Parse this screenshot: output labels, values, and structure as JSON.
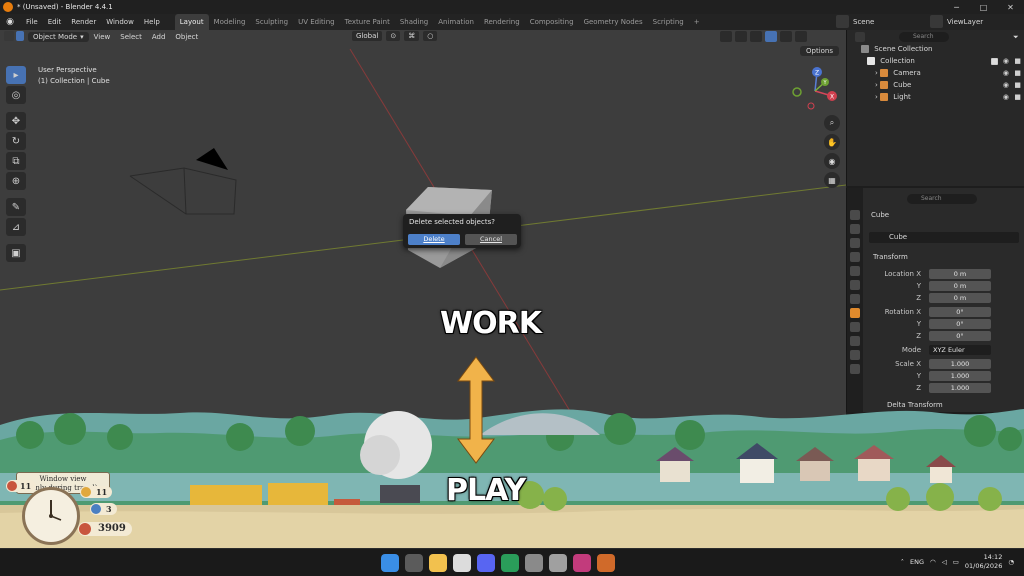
{
  "window": {
    "title": "* (Unsaved) - Blender 4.4.1",
    "minimize": "─",
    "maximize": "□",
    "close": "✕"
  },
  "menu": [
    "File",
    "Edit",
    "Render",
    "Window",
    "Help"
  ],
  "workspace_tabs": [
    "Layout",
    "Modeling",
    "Sculpting",
    "UV Editing",
    "Texture Paint",
    "Shading",
    "Animation",
    "Rendering",
    "Compositing",
    "Geometry Nodes",
    "Scripting"
  ],
  "workspace_add": "+",
  "scene_name": "Scene",
  "view_layer": "ViewLayer",
  "viewport": {
    "mode": "Object Mode",
    "menu": [
      "View",
      "Select",
      "Add",
      "Object"
    ],
    "orientation": "Global",
    "options_label": "Options",
    "perspective_label": "User Perspective",
    "collection_label": "(1) Collection | Cube",
    "gizmo_axes": [
      "Z",
      "X",
      "Y"
    ]
  },
  "dialog": {
    "question": "Delete selected objects?",
    "delete_label": "Delete",
    "cancel_label": "Cancel"
  },
  "overlay": {
    "top_text": "WORK",
    "bottom_text": "PLAY"
  },
  "game_widget": {
    "window_view_line1": "Window view",
    "window_view_line2": "(only during travel)",
    "counters": [
      "11",
      "3",
      "11"
    ],
    "money": "3909"
  },
  "outliner": {
    "search_placeholder": "Search",
    "scene_collection": "Scene Collection",
    "collection": "Collection",
    "objects": [
      "Camera",
      "Cube",
      "Light"
    ]
  },
  "properties": {
    "search_placeholder": "Search",
    "object_name": "Cube",
    "data_name": "Cube",
    "transform_header": "Transform",
    "location_label": "Location X",
    "location": [
      "0 m",
      "0 m",
      "0 m"
    ],
    "rotation_label": "Rotation X",
    "rotation": [
      "0°",
      "0°",
      "0°"
    ],
    "mode_label": "Mode",
    "rotation_mode": "XYZ Euler",
    "scale_label": "Scale X",
    "scale": [
      "1.000",
      "1.000",
      "1.000"
    ],
    "axis_y": "Y",
    "axis_z": "Z",
    "delta_transform": "Delta Transform"
  },
  "taskbar": {
    "language": "ENG",
    "time": "14:12",
    "date": "01/06/2026"
  },
  "colors": {
    "accent_blue": "#4772b3",
    "selection_row": "#334d80",
    "viewport_bg": "#3d3d3d",
    "active_prop_tab": "#e08a2c"
  }
}
